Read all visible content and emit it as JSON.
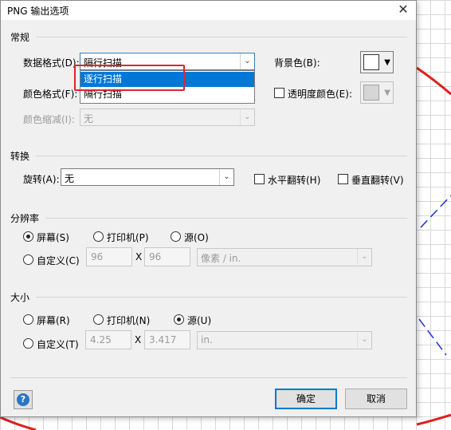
{
  "dialog": {
    "title": "PNG 输出选项",
    "close_glyph": "✕"
  },
  "general": {
    "section_label": "常规",
    "data_format_label": "数据格式(D):",
    "data_format_value": "隔行扫描",
    "data_format_options": [
      "逐行扫描",
      "隔行扫描"
    ],
    "selected_option_index": 0,
    "color_format_label": "颜色格式(F):",
    "color_reduction_label": "颜色缩减(I):",
    "color_reduction_value": "无",
    "background_label": "背景色(B):",
    "transparency_label": "透明度颜色(E):"
  },
  "transform": {
    "section_label": "转换",
    "rotate_label": "旋转(A):",
    "rotate_value": "无",
    "flip_h_label": "水平翻转(H)",
    "flip_v_label": "垂直翻转(V)"
  },
  "resolution": {
    "section_label": "分辨率",
    "screen_label": "屏幕(S)",
    "printer_label": "打印机(P)",
    "source_label": "源(O)",
    "custom_label": "自定义(C)",
    "width_value": "96",
    "height_value": "96",
    "times": "X",
    "unit_value": "像素 / in."
  },
  "size": {
    "section_label": "大小",
    "screen_label": "屏幕(R)",
    "printer_label": "打印机(N)",
    "source_label": "源(U)",
    "custom_label": "自定义(T)",
    "width_value": "4.25",
    "height_value": "3.417",
    "times": "X",
    "unit_value": "in."
  },
  "buttons": {
    "help_glyph": "?",
    "ok_label": "确定",
    "cancel_label": "取消"
  },
  "icons": {
    "dropdown_arrow": "⌄",
    "swatch_arrow": "▼"
  },
  "colors": {
    "selection": "#0078d7",
    "highlight_box": "#e0242c",
    "help_icon": "#2f74c0"
  }
}
